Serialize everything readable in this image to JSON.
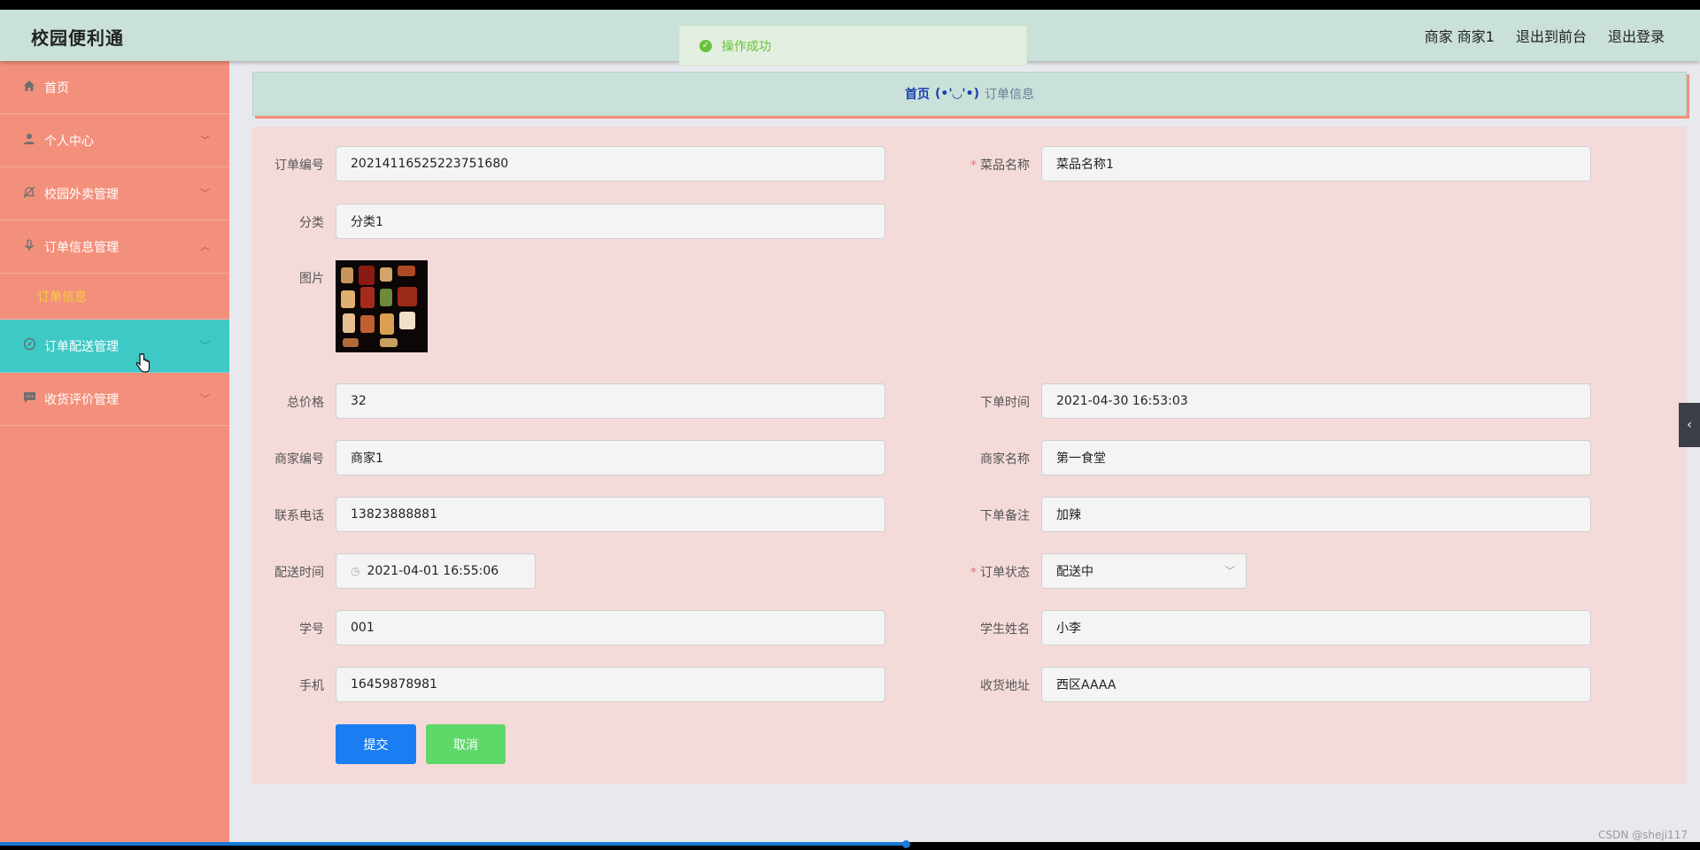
{
  "app": {
    "brand": "校园便利通"
  },
  "header": {
    "user_label": "商家 商家1",
    "exit_front": "退出到前台",
    "logout": "退出登录"
  },
  "toast": {
    "message": "操作成功"
  },
  "sidebar": {
    "items": [
      {
        "label": "首页",
        "icon": "home-icon"
      },
      {
        "label": "个人中心",
        "icon": "user-icon"
      },
      {
        "label": "校园外卖管理",
        "icon": "bell-off-icon"
      },
      {
        "label": "订单信息管理",
        "icon": "microphone-icon"
      },
      {
        "label": "订单配送管理",
        "icon": "compass-icon"
      },
      {
        "label": "收货评价管理",
        "icon": "chat-icon"
      }
    ],
    "sub_item": "订单信息"
  },
  "breadcrumb": {
    "home": "首页",
    "separator": "(•'◡'•)",
    "current": "订单信息"
  },
  "form": {
    "order_no": {
      "label": "订单编号",
      "value": "20214116525223751680"
    },
    "dish_name": {
      "label": "菜品名称",
      "value": "菜品名称1"
    },
    "category": {
      "label": "分类",
      "value": "分类1"
    },
    "image": {
      "label": "图片"
    },
    "total_price": {
      "label": "总价格",
      "value": "32"
    },
    "order_time": {
      "label": "下单时间",
      "value": "2021-04-30 16:53:03"
    },
    "merchant_no": {
      "label": "商家编号",
      "value": "商家1"
    },
    "merchant_name": {
      "label": "商家名称",
      "value": "第一食堂"
    },
    "phone": {
      "label": "联系电话",
      "value": "13823888881"
    },
    "order_note": {
      "label": "下单备注",
      "value": "加辣"
    },
    "delivery_time": {
      "label": "配送时间",
      "value": "2021-04-01 16:55:06"
    },
    "order_status": {
      "label": "订单状态",
      "value": "配送中"
    },
    "student_no": {
      "label": "学号",
      "value": "001"
    },
    "student_name": {
      "label": "学生姓名",
      "value": "小李"
    },
    "mobile": {
      "label": "手机",
      "value": "16459878981"
    },
    "address": {
      "label": "收货地址",
      "value": "西区AAAA"
    },
    "submit_label": "提交",
    "cancel_label": "取消"
  },
  "watermark": "CSDN @sheji117",
  "colors": {
    "sidebar": "#f3907c",
    "header": "#c9e1d8",
    "active": "#3ec9c6",
    "submit": "#1a7ef2",
    "cancel": "#5fd86a"
  }
}
